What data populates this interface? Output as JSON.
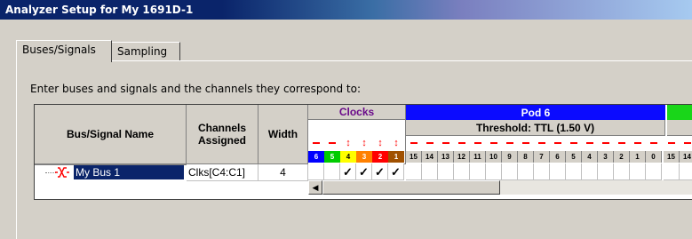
{
  "window": {
    "title": "Analyzer Setup for My 1691D-1"
  },
  "tabs": [
    {
      "label": "Buses/Signals"
    },
    {
      "label": "Sampling"
    }
  ],
  "instructions": "Enter buses and signals and the channels they correspond to:",
  "table": {
    "headers": {
      "name": "Bus/Signal Name",
      "channels": "Channels Assigned",
      "width": "Width"
    },
    "clocks": {
      "title": "Clocks",
      "labels": [
        "6",
        "5",
        "4",
        "3",
        "2",
        "1"
      ],
      "colors": [
        "#0000ff",
        "#00cc00",
        "#ffff00",
        "#ff8000",
        "#ff0000",
        "#a05000"
      ]
    },
    "pod": {
      "title": "Pod 6",
      "threshold": "Threshold: TTL (1.50 V)",
      "channels": [
        "15",
        "14",
        "13",
        "12",
        "11",
        "10",
        "9",
        "8",
        "7",
        "6",
        "5",
        "4",
        "3",
        "2",
        "1",
        "0"
      ],
      "next_channels": [
        "15",
        "14"
      ]
    },
    "rows": [
      {
        "name": "My Bus 1",
        "channels": "Clks[C4:C1]",
        "width": "4",
        "checks": [
          "",
          "",
          "✓",
          "✓",
          "✓",
          "✓"
        ]
      }
    ]
  },
  "icons": {
    "bus": "bus-icon",
    "scroll_left": "scroll-left-icon"
  }
}
